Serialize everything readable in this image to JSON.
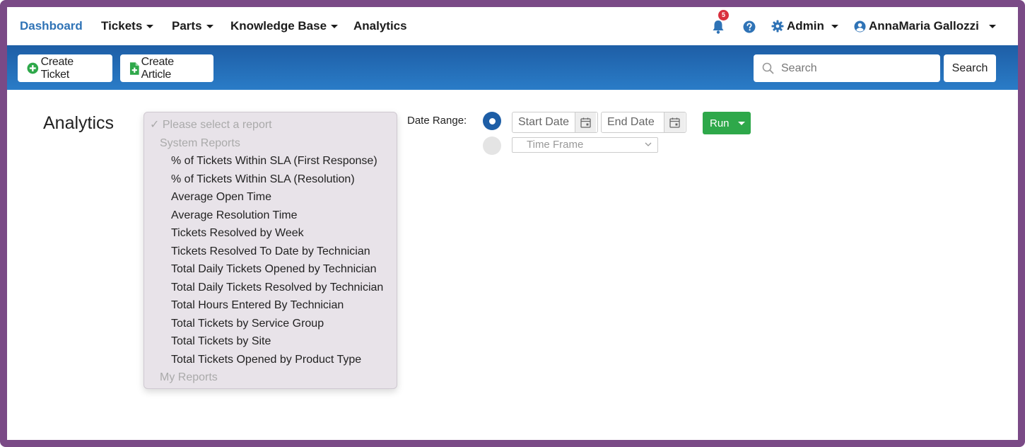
{
  "nav": {
    "dashboard": "Dashboard",
    "tickets": "Tickets",
    "parts": "Parts",
    "knowledge_base": "Knowledge Base",
    "analytics": "Analytics",
    "notification_count": "5",
    "admin": "Admin",
    "user": "AnnaMaria Gallozzi"
  },
  "toolbar": {
    "create_ticket": "Create Ticket",
    "create_article": "Create Article",
    "search_placeholder": "Search",
    "search_button": "Search"
  },
  "page": {
    "title": "Analytics",
    "date_range_label": "Date Range:",
    "start_date_placeholder": "Start Date",
    "end_date_placeholder": "End Date",
    "time_frame": "Time Frame",
    "run": "Run"
  },
  "report_select": {
    "placeholder": "Please select a report",
    "system_group": "System Reports",
    "options": [
      "% of Tickets Within SLA (First Response)",
      "% of Tickets Within SLA (Resolution)",
      "Average Open Time",
      "Average Resolution Time",
      "Tickets Resolved by Week",
      "Tickets Resolved To Date by Technician",
      "Total Daily Tickets Opened by Technician",
      "Total Daily Tickets Resolved by Technician",
      "Total Hours Entered By Technician",
      "Total Tickets by Service Group",
      "Total Tickets by Site",
      "Total Tickets Opened by Product Type"
    ],
    "my_group": "My Reports"
  },
  "colors": {
    "accent": "#2f73b6",
    "toolbar": "#1e5ea6",
    "run": "#2ea84a",
    "badge": "#d9303e",
    "frame": "#7a4a86"
  }
}
